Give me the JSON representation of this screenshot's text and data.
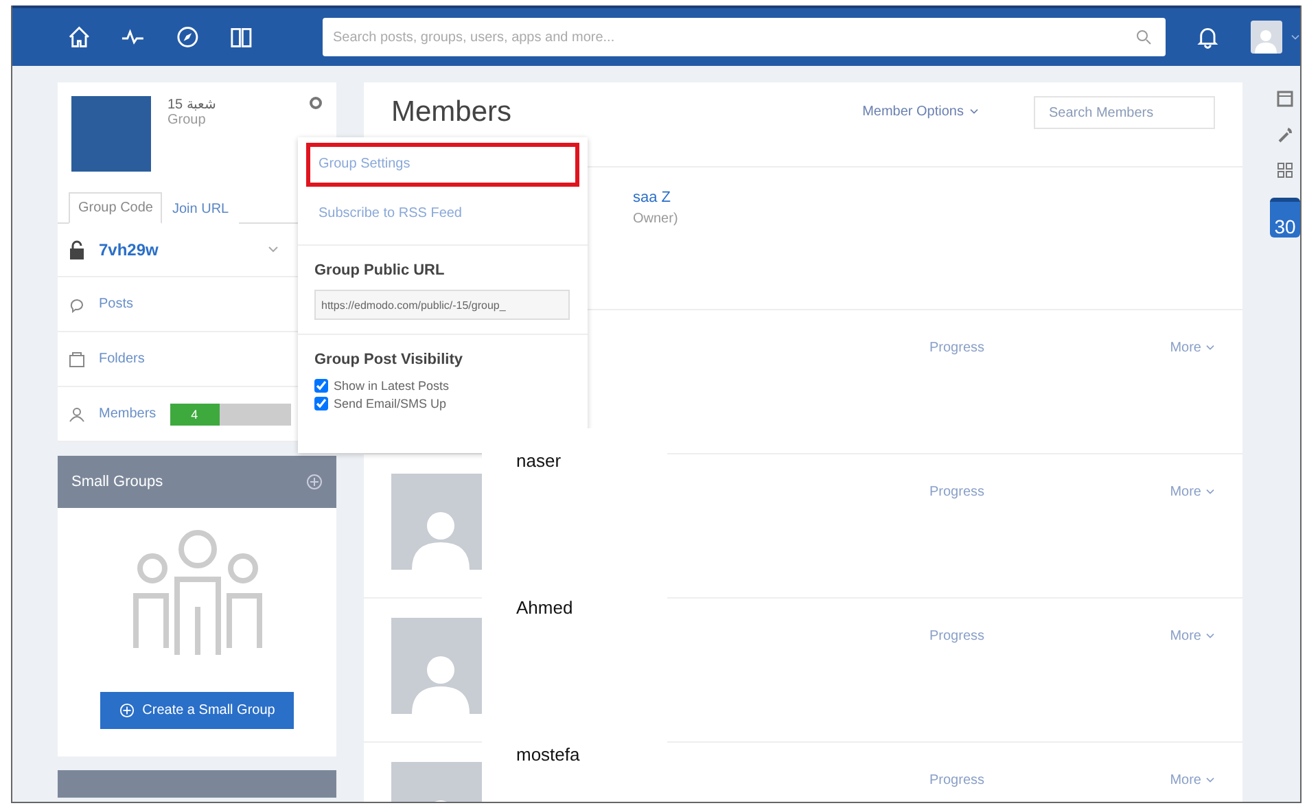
{
  "topbar": {
    "search": {
      "placeholder": "Search posts, groups, users, apps and more..."
    }
  },
  "group": {
    "name": "شعبة 15",
    "type": "Group",
    "tabs": [
      {
        "label": "Group Code",
        "selected": true
      },
      {
        "label": "Join URL",
        "selected": false
      }
    ],
    "code": "7vh29w",
    "nav": [
      {
        "kind": "posts",
        "label": "Posts"
      },
      {
        "kind": "folders",
        "label": "Folders"
      },
      {
        "kind": "members",
        "label": "Members",
        "badge": "4"
      }
    ]
  },
  "small_groups": {
    "title": "Small Groups",
    "button": "Create a Small Group"
  },
  "members": {
    "title": "Members",
    "options": "Member Options",
    "search": {
      "placeholder": "Search Members"
    },
    "owner": {
      "name": "saa Z",
      "role": "Owner)"
    },
    "rows": [
      {
        "avatar": false,
        "progress": "Progress",
        "more": "More"
      },
      {
        "avatar": true,
        "progress": "Progress",
        "more": "More"
      },
      {
        "avatar": true,
        "progress": "Progress",
        "more": "More"
      },
      {
        "avatar": true,
        "progress": "Progress",
        "more": "More"
      }
    ]
  },
  "menu": {
    "items": [
      {
        "label": "Group Settings",
        "selected": true
      },
      {
        "label": "Subscribe to RSS Feed",
        "selected": false
      }
    ],
    "public_url": {
      "title": "Group Public URL",
      "value": "https://edmodo.com/public/-15/group_"
    },
    "visibility": {
      "title": "Group Post Visibility",
      "options": [
        {
          "label": "Show in Latest Posts",
          "checked": true
        },
        {
          "label": "Send Email/SMS Up",
          "checked": true
        }
      ]
    }
  },
  "name_overlay": [
    "naser",
    "Ahmed",
    "mostefa"
  ],
  "right_rail": {
    "calendar": "30"
  }
}
